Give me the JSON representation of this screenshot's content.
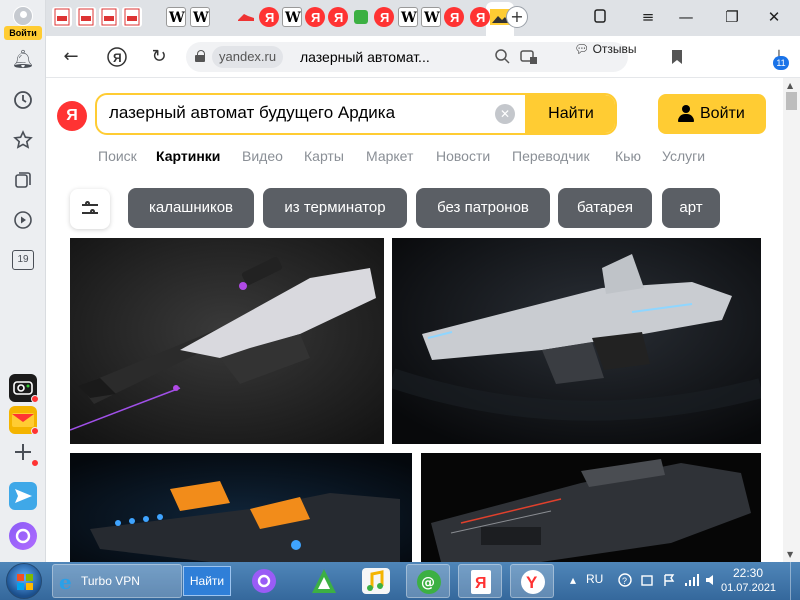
{
  "sidebar": {
    "login_label": "Войти",
    "calendar_badge": "19",
    "icons": [
      "bell-icon",
      "history-icon",
      "star-icon",
      "collections-icon",
      "video-icon"
    ]
  },
  "tabs": {
    "favicons": [
      "pdf",
      "pdf",
      "pdf",
      "pdf",
      "wikipedia",
      "wikipedia",
      "shoe",
      "yandex",
      "wikipedia",
      "yandex",
      "yandex",
      "green-square",
      "wikipedia",
      "wikipedia",
      "yandex",
      "images-active",
      "yandex"
    ],
    "new_tab": "+"
  },
  "addressbar": {
    "domain": "yandex.ru",
    "title": "лазерный автомат...",
    "reviews_label": "Отзывы",
    "downloads_count": "11"
  },
  "search": {
    "logo": "Я",
    "query": "лазерный автомат будущего Ардика",
    "clear": "✕",
    "submit_label": "Найти",
    "login_label": "Войти"
  },
  "services": [
    {
      "label": "Поиск",
      "active": false
    },
    {
      "label": "Картинки",
      "active": true
    },
    {
      "label": "Видео",
      "active": false
    },
    {
      "label": "Карты",
      "active": false
    },
    {
      "label": "Маркет",
      "active": false
    },
    {
      "label": "Новости",
      "active": false
    },
    {
      "label": "Переводчик",
      "active": false
    },
    {
      "label": "Кью",
      "active": false
    },
    {
      "label": "Услуги",
      "active": false
    }
  ],
  "chips": [
    "калашников",
    "из терминатор",
    "без патронов",
    "батарея",
    "арт"
  ],
  "colors": {
    "accent_yellow": "#ffcc33",
    "yandex_red": "#ff3333",
    "chip_gray": "#5b5f65"
  },
  "taskbar": {
    "vpn_label": "Turbo VPN",
    "vpn_button": "Найти",
    "lang": "RU",
    "time": "22:30",
    "date": "01.07.2021"
  }
}
